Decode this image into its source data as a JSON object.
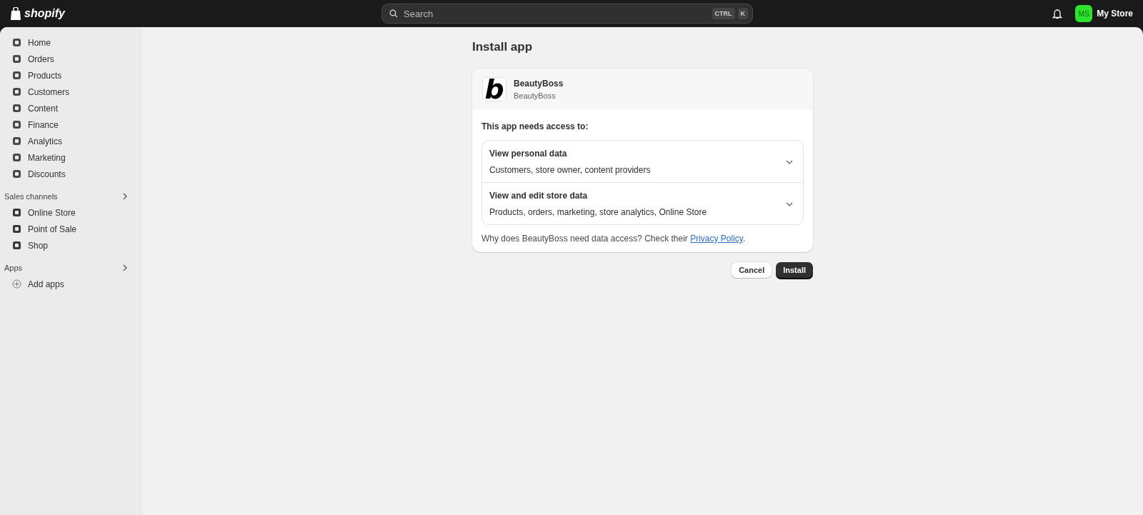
{
  "topbar": {
    "brand": "shopify",
    "search": {
      "placeholder": "Search",
      "shortcut": [
        "CTRL",
        "K"
      ]
    },
    "store": {
      "initials": "MS",
      "name": "My Store",
      "color": "#2de12d"
    }
  },
  "sidebar": {
    "items": [
      "Home",
      "Orders",
      "Products",
      "Customers",
      "Content",
      "Finance",
      "Analytics",
      "Marketing",
      "Discounts"
    ],
    "sections": [
      {
        "title": "Sales channels",
        "items": [
          "Online Store",
          "Point of Sale",
          "Shop"
        ]
      },
      {
        "title": "Apps",
        "items": [
          "Add apps"
        ]
      }
    ]
  },
  "page": {
    "title": "Install app",
    "app": {
      "logo_letter": "b",
      "name": "BeautyBoss",
      "developer": "BeautyBoss"
    },
    "access_heading": "This app needs access to:",
    "permissions": [
      {
        "title": "View personal data",
        "detail": "Customers, store owner, content providers",
        "expanded": false
      },
      {
        "title": "View and edit store data",
        "detail": "Products, orders, marketing, store analytics, Online Store",
        "expanded": false
      }
    ],
    "footnote": {
      "text": "Why does BeautyBoss need data access? Check their ",
      "link": "Privacy Policy",
      "end": "."
    },
    "buttons": [
      {
        "label": "Cancel",
        "kind": "secondary"
      },
      {
        "label": "Install",
        "kind": "primary"
      }
    ]
  }
}
